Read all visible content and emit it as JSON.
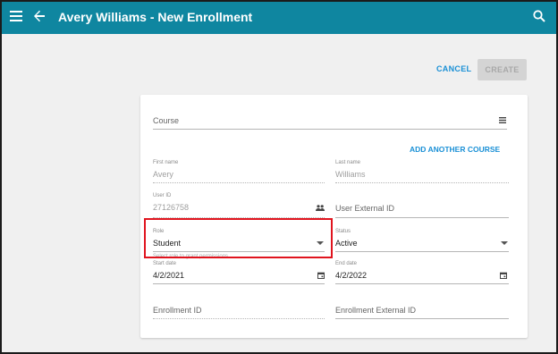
{
  "appbar": {
    "title": "Avery Williams - New Enrollment",
    "icons": {
      "menu": "menu-icon",
      "back": "back-arrow-icon",
      "search": "search-icon"
    },
    "color": "#0f86a0"
  },
  "actions": {
    "cancel_label": "CANCEL",
    "create_label": "CREATE"
  },
  "form": {
    "course": {
      "placeholder": "Course"
    },
    "add_course_label": "ADD ANOTHER COURSE",
    "first_name": {
      "label": "First name",
      "value": "Avery"
    },
    "last_name": {
      "label": "Last name",
      "value": "Williams"
    },
    "user_id": {
      "label": "User ID",
      "value": "27126758"
    },
    "user_external_id": {
      "placeholder": "User External ID"
    },
    "role": {
      "label": "Role",
      "value": "Student"
    },
    "role_hint": "Select role to grant permissions",
    "status": {
      "label": "Status",
      "value": "Active"
    },
    "start_date": {
      "label": "Start date",
      "value": "4/2/2021"
    },
    "end_date": {
      "label": "End date",
      "value": "4/2/2022"
    },
    "enrollment_id": {
      "placeholder": "Enrollment ID"
    },
    "enrollment_external_id": {
      "placeholder": "Enrollment External ID"
    }
  },
  "colors": {
    "accent": "#1a90d6",
    "highlight": "#e0141e"
  }
}
